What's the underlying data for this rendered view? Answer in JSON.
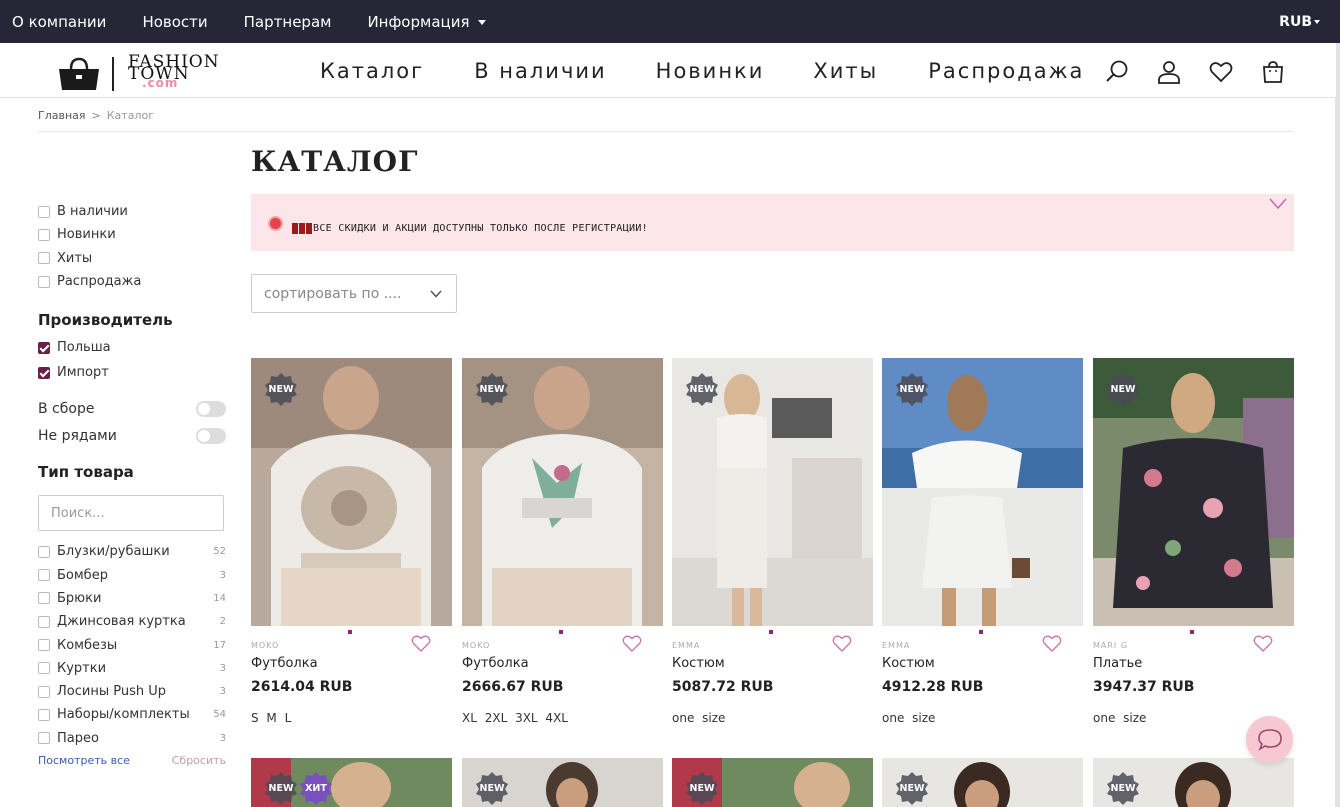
{
  "topbar": {
    "links": [
      "О компании",
      "Новости",
      "Партнерам",
      "Информация"
    ],
    "currency": "RUB"
  },
  "logo": {
    "line1": "FASHION",
    "line2": "TOWN",
    "suffix": ".com"
  },
  "header": {
    "nav": [
      "Каталог",
      "В наличии",
      "Новинки",
      "Хиты",
      "Распродажа"
    ],
    "icons": [
      "search-icon",
      "user-icon",
      "heart-icon",
      "cart-icon"
    ]
  },
  "breadcrumb": {
    "home": "Главная",
    "separator": ">",
    "current": "Каталог"
  },
  "page": {
    "title": "КАТАЛОГ",
    "promo": "ВСЕ СКИДКИ И АКЦИИ ДОСТУПНЫ ТОЛЬКО ПОСЛЕ РЕГИСТРАЦИИ!",
    "sort_placeholder": "сортировать по ...."
  },
  "filters": {
    "quick": [
      {
        "label": "В наличии",
        "checked": false
      },
      {
        "label": "Новинки",
        "checked": false
      },
      {
        "label": "Хиты",
        "checked": false
      },
      {
        "label": "Распродажа",
        "checked": false
      }
    ],
    "maker_title": "Производитель",
    "makers": [
      {
        "label": "Польша",
        "checked": true
      },
      {
        "label": "Импорт",
        "checked": true
      }
    ],
    "toggles": [
      {
        "label": "В сборе",
        "on": false
      },
      {
        "label": "Не рядами",
        "on": false
      }
    ],
    "type_title": "Тип товара",
    "type_search_placeholder": "Поиск...",
    "types": [
      {
        "label": "Блузки/рубашки",
        "count": "52"
      },
      {
        "label": "Бомбер",
        "count": "3"
      },
      {
        "label": "Брюки",
        "count": "14"
      },
      {
        "label": "Джинсовая куртка",
        "count": "2"
      },
      {
        "label": "Комбезы",
        "count": "17"
      },
      {
        "label": "Куртки",
        "count": "3"
      },
      {
        "label": "Лосины Push Up",
        "count": "3"
      },
      {
        "label": "Наборы/комплекты",
        "count": "54"
      },
      {
        "label": "Парео",
        "count": "3"
      }
    ],
    "show_all": "Посмотреть все",
    "reset": "Сбросить"
  },
  "products": [
    {
      "brand": "MOKO",
      "name": "Футболка",
      "price": "2614.04 RUB",
      "sizes": "S M L",
      "badge": "NEW"
    },
    {
      "brand": "MOKO",
      "name": "Футболка",
      "price": "2666.67 RUB",
      "sizes": "XL 2XL 3XL 4XL",
      "badge": "NEW"
    },
    {
      "brand": "EMMA",
      "name": "Костюм",
      "price": "5087.72 RUB",
      "sizes": "one size",
      "badge": "NEW"
    },
    {
      "brand": "EMMA",
      "name": "Костюм",
      "price": "4912.28 RUB",
      "sizes": "one size",
      "badge": "NEW"
    },
    {
      "brand": "MARI G",
      "name": "Платье",
      "price": "3947.37 RUB",
      "sizes": "one size",
      "badge": "NEW"
    }
  ],
  "next_row_badges": [
    [
      "NEW",
      "ХИТ"
    ],
    [
      "NEW"
    ],
    [
      "NEW"
    ],
    [
      "NEW"
    ],
    [
      "NEW"
    ]
  ],
  "colors": {
    "topbar": "#262636",
    "accent": "#6b2049",
    "promo_bg": "#fce6ea",
    "heart": "#c870a8",
    "badge": "#4a4a56"
  }
}
